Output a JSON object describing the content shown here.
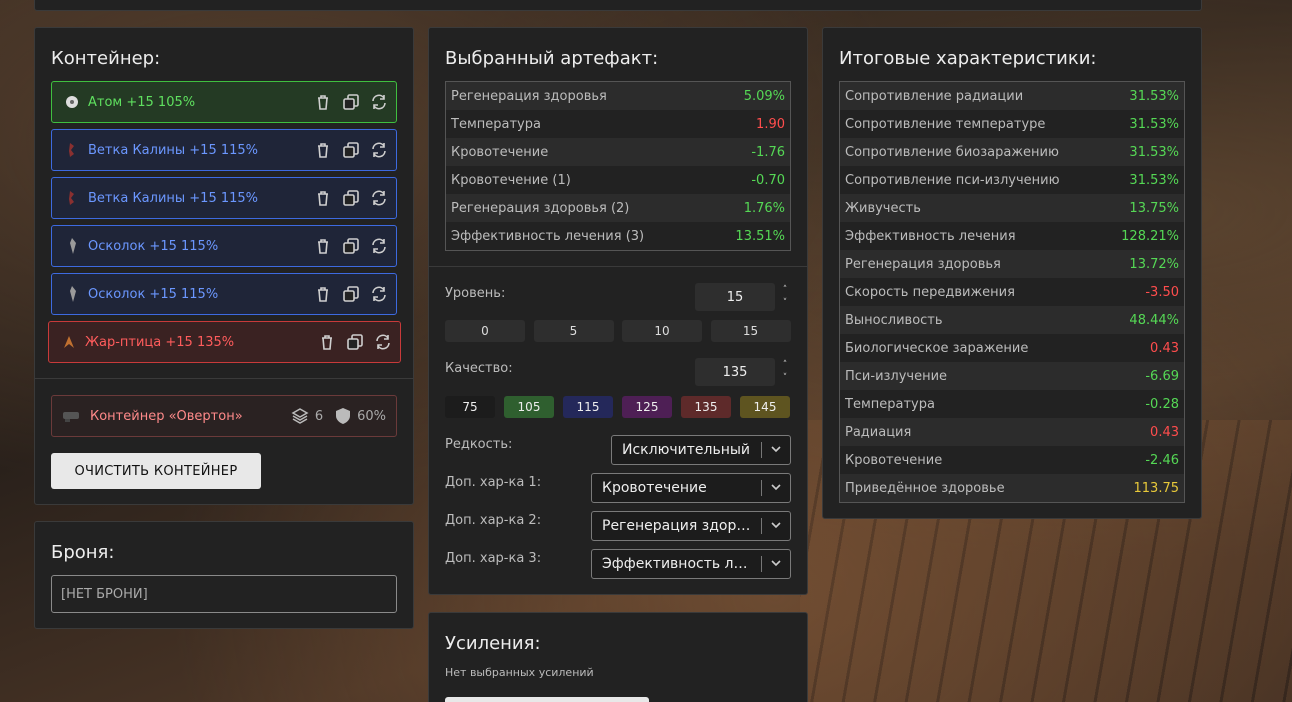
{
  "container": {
    "title": "Контейнер:",
    "artifacts": [
      {
        "label": "Атом +15 105%",
        "color": "green",
        "icon": "atom-artifact-icon"
      },
      {
        "label": "Ветка Калины +15 115%",
        "color": "blue",
        "icon": "kalina-branch-artifact-icon"
      },
      {
        "label": "Ветка Калины +15 115%",
        "color": "blue",
        "icon": "kalina-branch-artifact-icon"
      },
      {
        "label": "Осколок +15 115%",
        "color": "blue",
        "icon": "shard-artifact-icon"
      },
      {
        "label": "Осколок +15 115%",
        "color": "blue",
        "icon": "shard-artifact-icon"
      },
      {
        "label": "Жар-птица +15 135%",
        "color": "red",
        "icon": "firebird-artifact-icon"
      }
    ],
    "container_item": {
      "label": "Контейнер «Овертон»",
      "slots": "6",
      "protection": "60%"
    },
    "clear_button": "ОЧИСТИТЬ КОНТЕЙНЕР"
  },
  "armor": {
    "title": "Броня:",
    "value": "[НЕТ БРОНИ]"
  },
  "artifact": {
    "title": "Выбранный артефакт:",
    "stats": [
      {
        "name": "Регенерация здоровья",
        "value": "5.09%",
        "tone": "green"
      },
      {
        "name": "Температура",
        "value": "1.90",
        "tone": "red"
      },
      {
        "name": "Кровотечение",
        "value": "-1.76",
        "tone": "green"
      },
      {
        "name": "Кровотечение (1)",
        "value": "-0.70",
        "tone": "green"
      },
      {
        "name": "Регенерация здоровья (2)",
        "value": "1.76%",
        "tone": "green"
      },
      {
        "name": "Эффективность лечения (3)",
        "value": "13.51%",
        "tone": "green"
      }
    ],
    "level_label": "Уровень:",
    "level_value": "15",
    "level_presets": [
      "0",
      "5",
      "10",
      "15"
    ],
    "quality_label": "Качество:",
    "quality_value": "135",
    "quality_presets": [
      {
        "label": "75",
        "color": "#1c1c1c"
      },
      {
        "label": "105",
        "color": "#2f5f2f"
      },
      {
        "label": "115",
        "color": "#24285a"
      },
      {
        "label": "125",
        "color": "#4e1f55"
      },
      {
        "label": "135",
        "color": "#5e2a2a"
      },
      {
        "label": "145",
        "color": "#5e5420"
      }
    ],
    "rarity_label": "Редкость:",
    "rarity_value": "Исключительный",
    "extra1_label": "Доп. хар-ка 1:",
    "extra1_value": "Кровотечение",
    "extra2_label": "Доп. хар-ка 2:",
    "extra2_value": "Регенерация здоровья",
    "extra3_label": "Доп. хар-ка 3:",
    "extra3_value": "Эффективность лечения"
  },
  "enhancements": {
    "title": "Усиления:",
    "empty_text": "Нет выбранных усилений"
  },
  "totals": {
    "title": "Итоговые характеристики:",
    "stats": [
      {
        "name": "Сопротивление радиации",
        "value": "31.53%",
        "tone": "green"
      },
      {
        "name": "Сопротивление температуре",
        "value": "31.53%",
        "tone": "green"
      },
      {
        "name": "Сопротивление биозаражению",
        "value": "31.53%",
        "tone": "green"
      },
      {
        "name": "Сопротивление пси-излучению",
        "value": "31.53%",
        "tone": "green"
      },
      {
        "name": "Живучесть",
        "value": "13.75%",
        "tone": "green"
      },
      {
        "name": "Эффективность лечения",
        "value": "128.21%",
        "tone": "green"
      },
      {
        "name": "Регенерация здоровья",
        "value": "13.72%",
        "tone": "green"
      },
      {
        "name": "Скорость передвижения",
        "value": "-3.50",
        "tone": "red"
      },
      {
        "name": "Выносливость",
        "value": "48.44%",
        "tone": "green"
      },
      {
        "name": "Биологическое заражение",
        "value": "0.43",
        "tone": "red"
      },
      {
        "name": "Пси-излучение",
        "value": "-6.69",
        "tone": "green"
      },
      {
        "name": "Температура",
        "value": "-0.28",
        "tone": "green"
      },
      {
        "name": "Радиация",
        "value": "0.43",
        "tone": "red"
      },
      {
        "name": "Кровотечение",
        "value": "-2.46",
        "tone": "green"
      },
      {
        "name": "Приведённое здоровье",
        "value": "113.75",
        "tone": "yellow"
      }
    ]
  }
}
